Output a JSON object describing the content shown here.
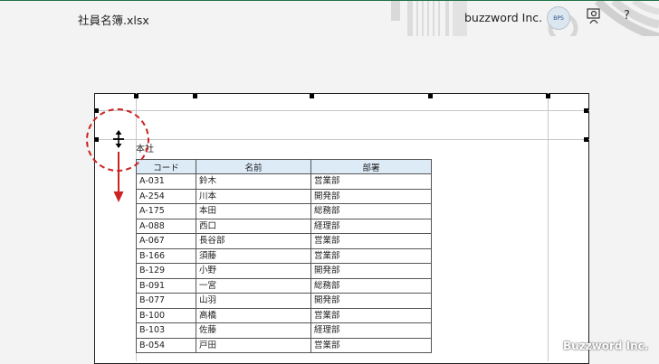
{
  "title_bar": {
    "document_title": "社員名簿.xlsx",
    "user_name": "buzzword Inc.",
    "avatar_text": "BPS",
    "help_label": "?"
  },
  "sheet": {
    "title": "本社",
    "headers": [
      "コード",
      "名前",
      "部署"
    ],
    "rows": [
      [
        "A-031",
        "鈴木",
        "営業部"
      ],
      [
        "A-254",
        "川本",
        "開発部"
      ],
      [
        "A-175",
        "本田",
        "総務部"
      ],
      [
        "A-088",
        "西口",
        "経理部"
      ],
      [
        "A-067",
        "長谷部",
        "営業部"
      ],
      [
        "B-166",
        "須藤",
        "営業部"
      ],
      [
        "B-129",
        "小野",
        "開発部"
      ],
      [
        "B-091",
        "一宮",
        "総務部"
      ],
      [
        "B-077",
        "山羽",
        "開発部"
      ],
      [
        "B-100",
        "高橋",
        "営業部"
      ],
      [
        "B-103",
        "佐藤",
        "経理部"
      ],
      [
        "B-054",
        "戸田",
        "営業部"
      ]
    ]
  },
  "watermark": "Buzzword Inc.",
  "colors": {
    "header_fill": "#ddebf7",
    "annotation": "#cc2222",
    "title_bar_accent": "#217346"
  },
  "icons": {
    "share": "share-person-icon",
    "move_cursor": "move-resize-cursor-icon",
    "arrow": "down-arrow-icon"
  }
}
